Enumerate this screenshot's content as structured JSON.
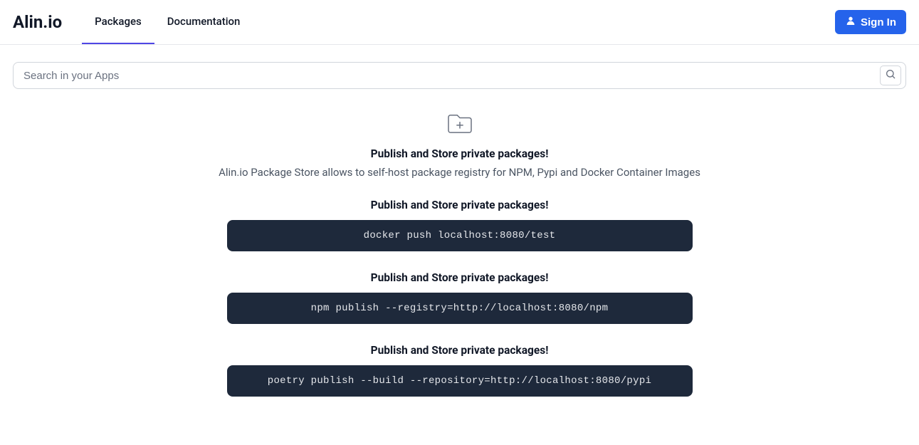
{
  "header": {
    "logo": "Alin.io",
    "nav": [
      {
        "label": "Packages",
        "active": true
      },
      {
        "label": "Documentation",
        "active": false
      }
    ],
    "signin_label": "Sign In"
  },
  "search": {
    "placeholder": "Search in your Apps"
  },
  "intro": {
    "heading": "Publish and Store private packages!",
    "description": "Alin.io Package Store allows to self-host package registry for NPM, Pypi and Docker Container Images"
  },
  "examples": [
    {
      "title": "Publish and Store private packages!",
      "code": "docker push localhost:8080/test"
    },
    {
      "title": "Publish and Store private packages!",
      "code": "npm publish --registry=http://localhost:8080/npm"
    },
    {
      "title": "Publish and Store private packages!",
      "code": "poetry publish --build --repository=http://localhost:8080/pypi"
    }
  ]
}
